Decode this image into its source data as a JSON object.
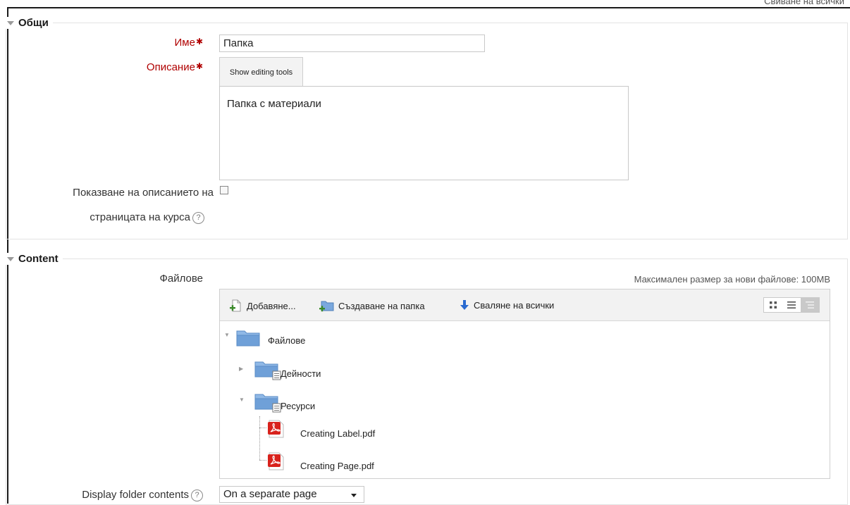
{
  "clipped_top_text": "Свиване на всички",
  "sections": {
    "general": {
      "title": "Общи"
    },
    "content": {
      "title": "Content"
    }
  },
  "fields": {
    "name": {
      "label": "Име",
      "value": "Папка"
    },
    "description": {
      "label": "Описание",
      "tools_button": "Show editing tools",
      "text": "Папка с материали"
    },
    "show_description": {
      "label_line1": "Показване на описанието на",
      "label_line2": "страницата на курса",
      "checked": false
    },
    "files": {
      "label": "Файлове",
      "max_size": "Максимален размер за нови файлове: 100MB"
    },
    "display": {
      "label": "Display folder contents",
      "selected": "On a separate page"
    }
  },
  "filemanager": {
    "toolbar": {
      "add": "Добавяне...",
      "create_folder": "Създаване на папка",
      "download_all": "Сваляне на всички"
    },
    "tree": {
      "root": "Файлове",
      "folder1": "Дейности",
      "folder2": "Ресурси",
      "file1": "Creating Label.pdf",
      "file2": "Creating Page.pdf"
    }
  },
  "icons": {
    "help": "question-circle-icon",
    "folder": "folder-icon",
    "pdf": "pdf-file-icon"
  },
  "colors": {
    "required": "#b00000",
    "folder": "#6fa0d8"
  }
}
